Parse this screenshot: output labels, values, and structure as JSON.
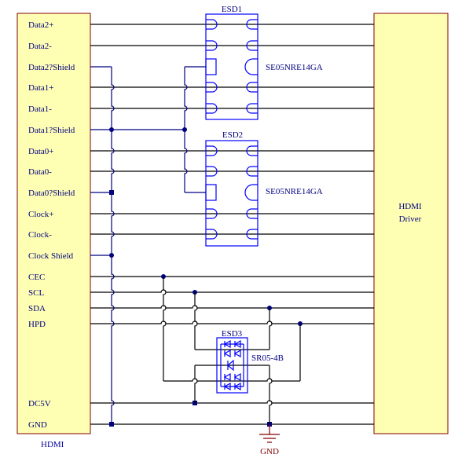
{
  "connector": {
    "label": "HDMI",
    "pins": [
      "Data2+",
      "Data2-",
      "Data2?Shield",
      "Data1+",
      "Data1-",
      "Data1?Shield",
      "Data0+",
      "Data0-",
      "Data0?Shield",
      "Clock+",
      "Clock-",
      "Clock Shield",
      "CEC",
      "SCL",
      "SDA",
      "HPD",
      "DC5V",
      "GND"
    ]
  },
  "driver": {
    "line1": "HDMI",
    "line2": "Driver"
  },
  "components": [
    {
      "ref": "ESD1",
      "part": "SE05NRE14GA"
    },
    {
      "ref": "ESD2",
      "part": "SE05NRE14GA"
    },
    {
      "ref": "ESD3",
      "part": "SR05-4B"
    }
  ],
  "ground": {
    "label": "GND"
  },
  "colors": {
    "box_fill": "#ffffb4",
    "box_border": "#800000",
    "signal_wire": "#000000",
    "shield_wire": "#000080",
    "component": "#0000ff",
    "label_text": "#000080",
    "ground": "#800000"
  }
}
